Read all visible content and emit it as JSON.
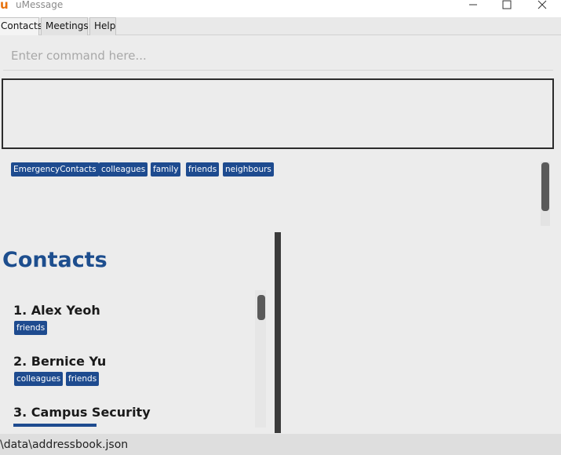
{
  "window": {
    "title": "uMessage",
    "logo_letter": "u"
  },
  "tabs": [
    {
      "label": "Contacts",
      "selected": true
    },
    {
      "label": "Meetings",
      "selected": false
    },
    {
      "label": "Help",
      "selected": false
    }
  ],
  "command": {
    "placeholder": "Enter command here...",
    "value": ""
  },
  "result": {
    "text": ""
  },
  "tag_filters": [
    "EmergencyContacts",
    "colleagues",
    "family",
    "friends",
    "neighbours"
  ],
  "contacts_panel": {
    "heading": "Contacts",
    "persons": [
      {
        "name": "1.  Alex Yeoh",
        "tags": [
          "friends"
        ]
      },
      {
        "name": "2.  Bernice Yu",
        "tags": [
          "colleagues",
          "friends"
        ]
      },
      {
        "name": "3.  Campus Security",
        "tags": []
      }
    ]
  },
  "status_bar": {
    "path": "\\data\\addressbook.json"
  },
  "colors": {
    "tag_background": "#1e4b8f",
    "heading": "#1d4e8e",
    "logo": "#e8720c"
  }
}
